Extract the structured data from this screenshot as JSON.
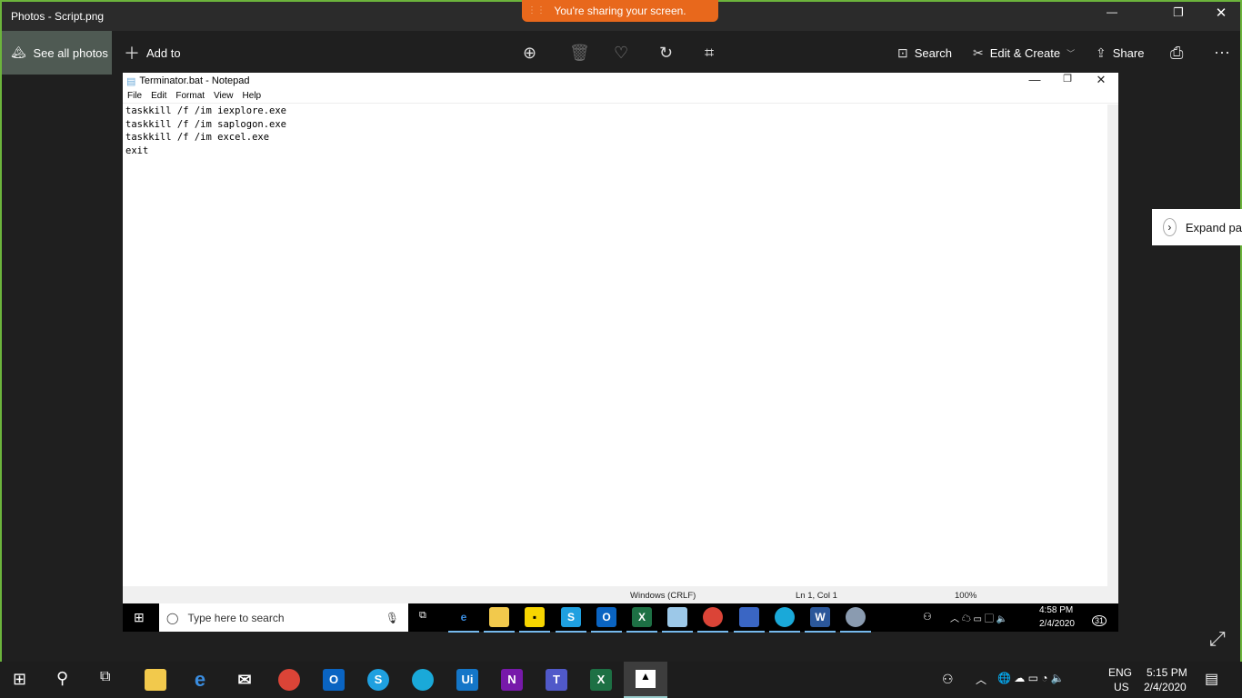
{
  "photos": {
    "title": "Photos - Script.png",
    "see_all": "See all photos",
    "add_to": "Add to",
    "search": "Search",
    "edit_create": "Edit & Create",
    "share": "Share"
  },
  "share_banner": "You're sharing your screen.",
  "notepad": {
    "title": "Terminator.bat - Notepad",
    "menu": [
      "File",
      "Edit",
      "Format",
      "View",
      "Help"
    ],
    "content": "taskkill /f /im iexplore.exe\ntaskkill /f /im saplogon.exe\ntaskkill /f /im excel.exe\nexit",
    "status": {
      "encoding": "Windows (CRLF)",
      "position": "Ln 1, Col 1",
      "zoom": "100%"
    }
  },
  "inner_taskbar": {
    "search_placeholder": "Type here to search",
    "time": "4:58 PM",
    "date": "2/4/2020",
    "notifications": "31"
  },
  "expand_panel": "Expand pa",
  "taskbar": {
    "lang": "ENG",
    "region": "US",
    "time": "5:15 PM",
    "date": "2/4/2020"
  }
}
